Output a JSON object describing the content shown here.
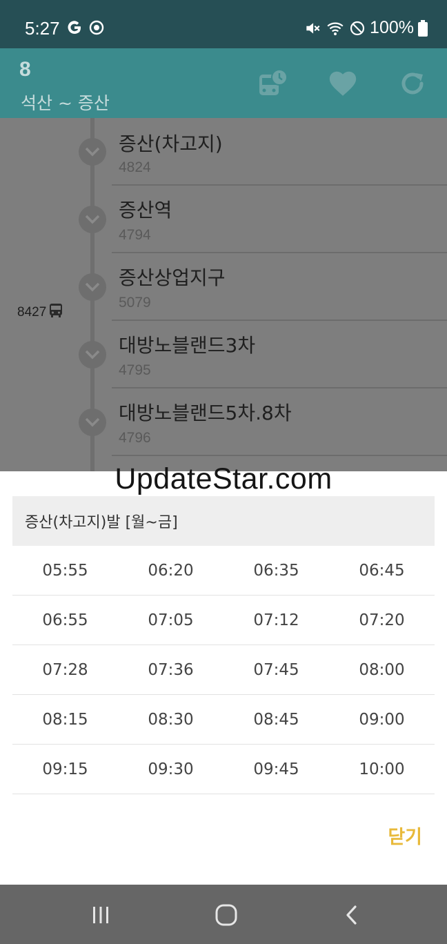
{
  "status_bar": {
    "time": "5:27",
    "battery": "100%",
    "icons": [
      "google-g-icon",
      "target-icon",
      "mute-icon",
      "wifi-icon",
      "do-not-disturb-icon",
      "battery-icon"
    ]
  },
  "app_bar": {
    "route_number": "8",
    "route_span": "석산 ~ 증산",
    "actions": [
      "bus-schedule-icon",
      "favorite-heart-icon",
      "refresh-icon"
    ]
  },
  "stops": [
    {
      "name": "증산(차고지)",
      "id": "4824"
    },
    {
      "name": "증산역",
      "id": "4794"
    },
    {
      "name": "증산상업지구",
      "id": "5079"
    },
    {
      "name": "대방노블랜드3차",
      "id": "4795"
    },
    {
      "name": "대방노블랜드5차.8차",
      "id": "4796"
    }
  ],
  "bus_marker": {
    "vehicle": "8427",
    "icon": "bus-icon"
  },
  "watermark": "UpdateStar.com",
  "dialog": {
    "title": "증산(차고지)발 [월~금]",
    "rows": [
      [
        "05:55",
        "06:20",
        "06:35",
        "06:45"
      ],
      [
        "06:55",
        "07:05",
        "07:12",
        "07:20"
      ],
      [
        "07:28",
        "07:36",
        "07:45",
        "08:00"
      ],
      [
        "08:15",
        "08:30",
        "08:45",
        "09:00"
      ],
      [
        "09:15",
        "09:30",
        "09:45",
        "10:00"
      ]
    ],
    "close_label": "닫기",
    "accent_color": "#e8b93a"
  },
  "nav_bar": {
    "buttons": [
      "recent-apps-icon",
      "home-icon",
      "back-icon"
    ]
  },
  "colors": {
    "status_bar": "#264f55",
    "app_bar": "#3b8b8d",
    "scrim_list": "#7e7e7e",
    "nav_bar": "#666666"
  }
}
